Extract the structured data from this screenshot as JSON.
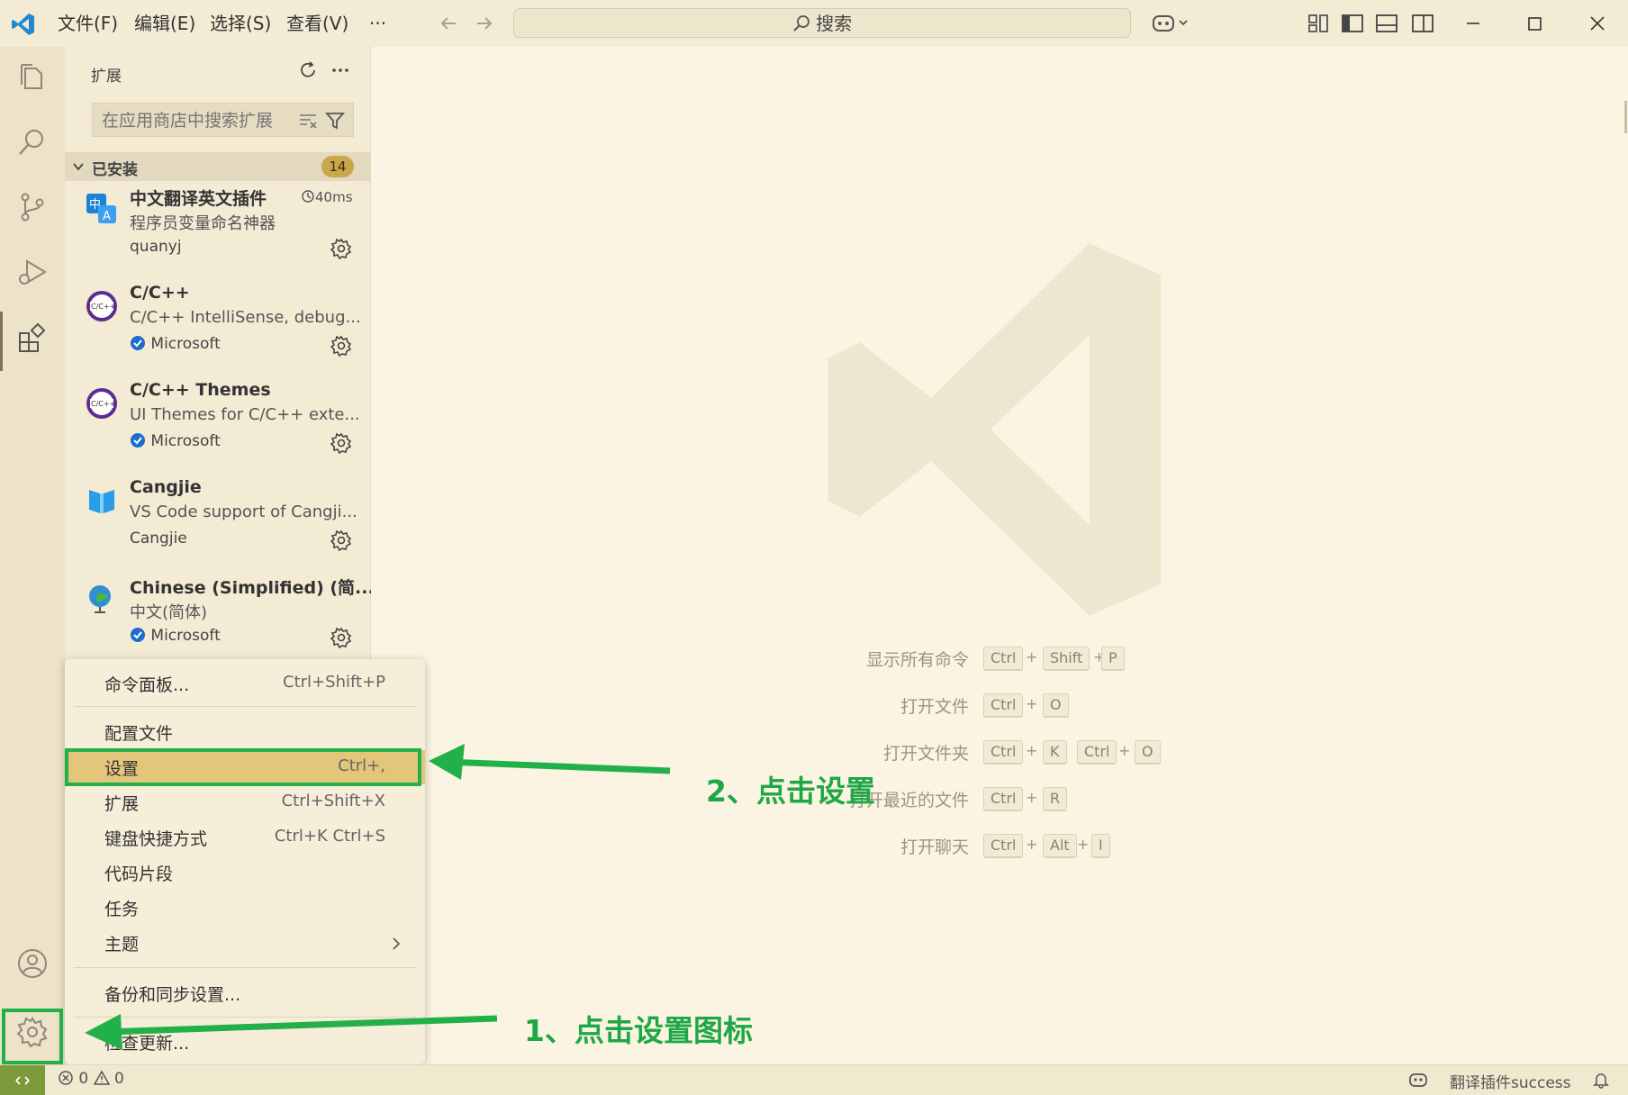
{
  "colors": {
    "accent": "#22b04a",
    "titlebar": "#f3ebd3",
    "selected_menu": "#e4c67a",
    "badge": "#c9a74a"
  },
  "titlebar": {
    "menus": [
      "文件(F)",
      "编辑(E)",
      "选择(S)",
      "查看(V)",
      "···"
    ],
    "search": "搜索"
  },
  "sidebar": {
    "title": "扩展",
    "search_placeholder": "在应用商店中搜索扩展",
    "installed_label": "已安装",
    "installed_count": "14",
    "extensions": [
      {
        "name": "中文翻译英文插件",
        "desc": "程序员变量命名神器",
        "publisher": "quanyj",
        "time": "40ms",
        "verified": false
      },
      {
        "name": "C/C++",
        "desc": "C/C++ IntelliSense, debug...",
        "publisher": "Microsoft",
        "verified": true
      },
      {
        "name": "C/C++ Themes",
        "desc": "UI Themes for C/C++ exte...",
        "publisher": "Microsoft",
        "verified": true
      },
      {
        "name": "Cangjie",
        "desc": "VS Code support of Cangji...",
        "publisher": "Cangjie",
        "verified": false
      },
      {
        "name": "Chinese (Simplified) (简...",
        "desc": "中文(简体)",
        "publisher": "Microsoft",
        "verified": true
      }
    ]
  },
  "editor": {
    "hints": [
      {
        "label": "显示所有命令",
        "keys": [
          "Ctrl",
          "+",
          "Shift",
          "+",
          "P"
        ]
      },
      {
        "label": "打开文件",
        "keys": [
          "Ctrl",
          "+",
          "O"
        ]
      },
      {
        "label": "打开文件夹",
        "keys": [
          "Ctrl",
          "+",
          "K",
          "Ctrl",
          "+",
          "O"
        ]
      },
      {
        "label": "打开最近的文件",
        "keys": [
          "Ctrl",
          "+",
          "R"
        ]
      },
      {
        "label": "打开聊天",
        "keys": [
          "Ctrl",
          "+",
          "Alt",
          "+",
          "I"
        ]
      }
    ]
  },
  "context_menu": {
    "items": [
      {
        "label": "命令面板...",
        "key": "Ctrl+Shift+P"
      },
      {
        "label": "配置文件",
        "key": ""
      },
      {
        "label": "设置",
        "key": "Ctrl+,"
      },
      {
        "label": "扩展",
        "key": "Ctrl+Shift+X"
      },
      {
        "label": "键盘快捷方式",
        "key": "Ctrl+K Ctrl+S"
      },
      {
        "label": "代码片段",
        "key": ""
      },
      {
        "label": "任务",
        "key": ""
      },
      {
        "label": "主题",
        "key": ""
      },
      {
        "label": "备份和同步设置...",
        "key": ""
      },
      {
        "label": "检查更新...",
        "key": ""
      }
    ]
  },
  "statusbar": {
    "errors": "0",
    "warnings": "0",
    "right_text": "翻译插件success"
  },
  "annotations": {
    "step1": "1、点击设置图标",
    "step2": "2、点击设置"
  }
}
